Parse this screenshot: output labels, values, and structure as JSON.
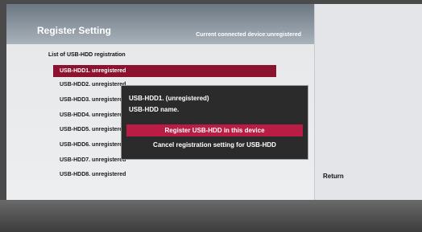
{
  "header": {
    "title": "Register Setting",
    "connected_device": "Current connected device:unregistered"
  },
  "list": {
    "title": "List of USB-HDD registration",
    "items": [
      "USB-HDD1.  unregistered",
      "USB-HDD2.  unregistered",
      "USB-HDD3.  unregistered",
      "USB-HDD4.  unregistered",
      "USB-HDD5.  unregistered",
      "USB-HDD6.  unregistered",
      "USB-HDD7.  unregistered",
      "USB-HDD8.  unregistered"
    ],
    "selected_index": 0
  },
  "dialog": {
    "line1": "USB-HDD1. (unregistered)",
    "line2": "USB-HDD name.",
    "register_label": "Register USB-HDD in this device",
    "cancel_label": "Cancel registration setting for USB-HDD"
  },
  "side": {
    "return_label": "Return"
  },
  "colors": {
    "selected_row": "#8b1330",
    "dialog_button_active": "#b91d44",
    "dialog_background": "#2b2b2b"
  }
}
